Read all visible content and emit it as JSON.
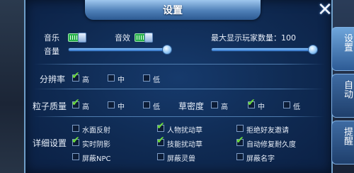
{
  "dialog": {
    "title": "设置"
  },
  "tabs": [
    {
      "label": "设置"
    },
    {
      "label": "自动"
    },
    {
      "label": "提醒"
    }
  ],
  "audio": {
    "music_label": "音乐",
    "music_on": true,
    "sfx_label": "音效",
    "sfx_on": true,
    "volume_label": "音量",
    "volume_level": 1.0
  },
  "players": {
    "label": "最大显示玩家数量：100",
    "max": 100
  },
  "resolution": {
    "label": "分辨率",
    "options": [
      {
        "label": "高",
        "checked": true
      },
      {
        "label": "中",
        "checked": false
      },
      {
        "label": "低",
        "checked": false
      }
    ]
  },
  "particle": {
    "label": "粒子质量",
    "options": [
      {
        "label": "高",
        "checked": true
      },
      {
        "label": "中",
        "checked": false
      },
      {
        "label": "低",
        "checked": false
      }
    ]
  },
  "grass": {
    "label": "草密度",
    "options": [
      {
        "label": "高",
        "checked": false
      },
      {
        "label": "中",
        "checked": true
      },
      {
        "label": "低",
        "checked": false
      }
    ]
  },
  "details": {
    "label": "详细设置",
    "options": [
      {
        "label": "水面反射",
        "checked": false
      },
      {
        "label": "人物扰动草",
        "checked": true
      },
      {
        "label": "拒绝好友邀请",
        "checked": false
      },
      {
        "label": "实时阴影",
        "checked": true
      },
      {
        "label": "技能扰动草",
        "checked": true
      },
      {
        "label": "自动修复耐久度",
        "checked": true
      },
      {
        "label": "屏蔽NPC",
        "checked": false
      },
      {
        "label": "屏蔽灵兽",
        "checked": false
      },
      {
        "label": "屏蔽名字",
        "checked": false
      }
    ]
  },
  "colors": {
    "accent": "#6ede3b",
    "panel": "#0f2a52",
    "toggle_on": "#27b04a"
  }
}
